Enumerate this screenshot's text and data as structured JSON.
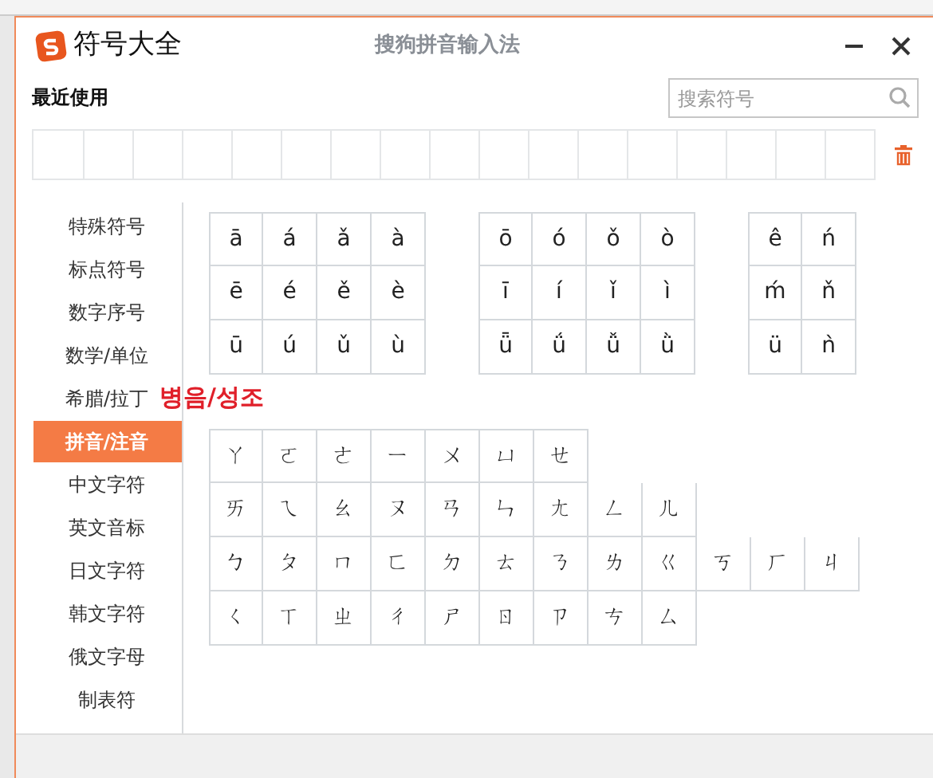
{
  "window": {
    "title": "符号大全",
    "subtitle": "搜狗拼音输入法"
  },
  "recent": {
    "label": "最近使用"
  },
  "search": {
    "placeholder": "搜索符号"
  },
  "sidebar": {
    "items": [
      {
        "label": "特殊符号",
        "selected": false
      },
      {
        "label": "标点符号",
        "selected": false
      },
      {
        "label": "数字序号",
        "selected": false
      },
      {
        "label": "数学/单位",
        "selected": false
      },
      {
        "label": "希腊/拉丁",
        "selected": false
      },
      {
        "label": "拼音/注音",
        "selected": true
      },
      {
        "label": "中文字符",
        "selected": false
      },
      {
        "label": "英文音标",
        "selected": false
      },
      {
        "label": "日文字符",
        "selected": false
      },
      {
        "label": "韩文字符",
        "selected": false
      },
      {
        "label": "俄文字母",
        "selected": false
      },
      {
        "label": "制表符",
        "selected": false
      }
    ]
  },
  "annotation": "병음/성조",
  "pinyin_grids": [
    {
      "rows": [
        [
          "ā",
          "á",
          "ǎ",
          "à"
        ],
        [
          "ē",
          "é",
          "ě",
          "è"
        ],
        [
          "ū",
          "ú",
          "ǔ",
          "ù"
        ]
      ]
    },
    {
      "rows": [
        [
          "ō",
          "ó",
          "ǒ",
          "ò"
        ],
        [
          "ī",
          "í",
          "ǐ",
          "ì"
        ],
        [
          "ǖ",
          "ǘ",
          "ǚ",
          "ǜ"
        ]
      ]
    },
    {
      "rows": [
        [
          "ê",
          "ń"
        ],
        [
          "ḿ",
          "ň"
        ],
        [
          "ü",
          "ǹ"
        ]
      ]
    }
  ],
  "zhuyin_grid": {
    "rows": [
      [
        "ㄚ",
        "ㄛ",
        "ㄜ",
        "ㄧ",
        "ㄨ",
        "ㄩ",
        "ㄝ"
      ],
      [
        "ㄞ",
        "ㄟ",
        "ㄠ",
        "ㄡ",
        "ㄢ",
        "ㄣ",
        "ㄤ",
        "ㄥ",
        "ㄦ"
      ],
      [
        "ㄅ",
        "ㄆ",
        "ㄇ",
        "ㄈ",
        "ㄉ",
        "ㄊ",
        "ㄋ",
        "ㄌ",
        "ㄍ",
        "ㄎ",
        "ㄏ",
        "ㄐ"
      ],
      [
        "ㄑ",
        "ㄒ",
        "ㄓ",
        "ㄔ",
        "ㄕ",
        "ㄖ",
        "ㄗ",
        "ㄘ",
        "ㄙ"
      ]
    ]
  }
}
